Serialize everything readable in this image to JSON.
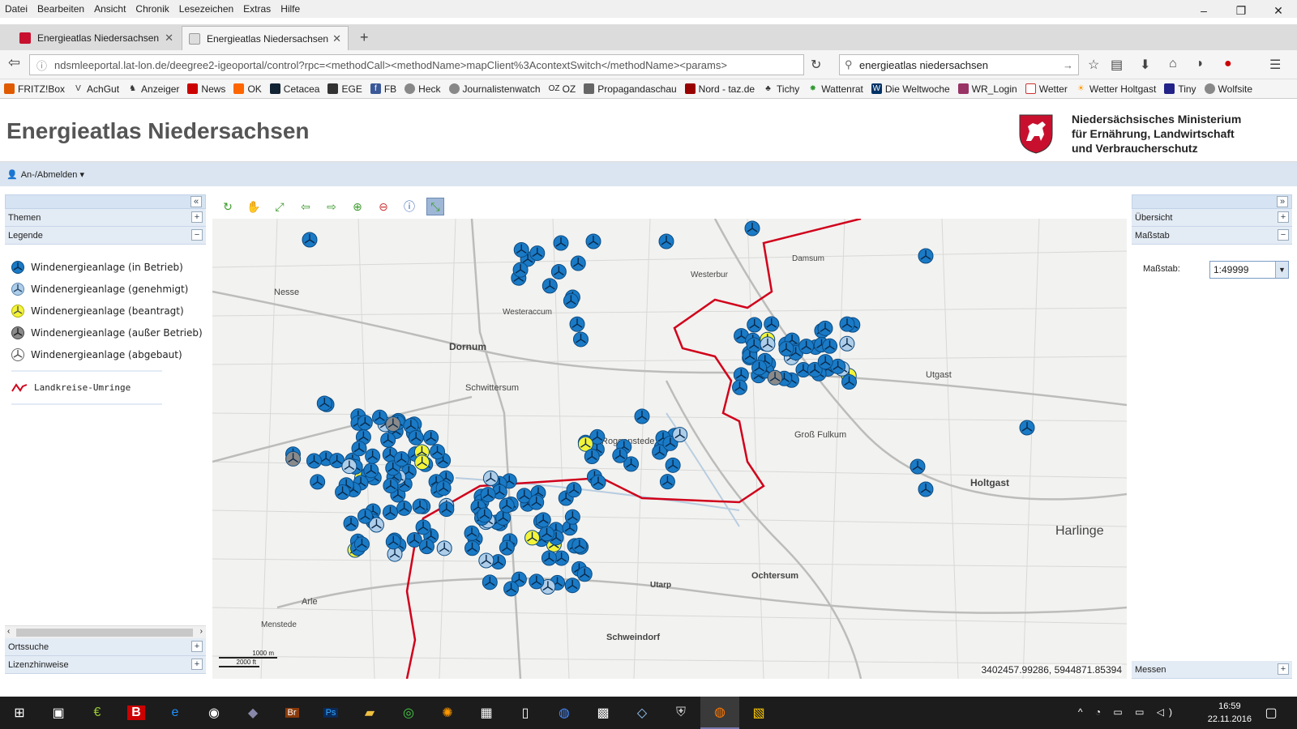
{
  "browser": {
    "menu": [
      "Datei",
      "Bearbeiten",
      "Ansicht",
      "Chronik",
      "Lesezeichen",
      "Extras",
      "Hilfe"
    ],
    "window_controls": {
      "minimize": "–",
      "maximize": "❐",
      "close": "✕"
    },
    "tabs": [
      {
        "label": "Energieatlas Niedersachsen",
        "active": false
      },
      {
        "label": "Energieatlas Niedersachsen",
        "active": true
      }
    ],
    "new_tab": "+",
    "url": "ndsmleeportal.lat-lon.de/deegree2-igeoportal/control?rpc=<methodCall><methodName>mapClient%3AcontextSwitch</methodName><params>",
    "search_value": "energieatlas niedersachsen",
    "bookmarks": [
      "FRITZ!Box",
      "AchGut",
      "Anzeiger",
      "News",
      "OK",
      "Cetacea",
      "EGE",
      "FB",
      "Heck",
      "Journalistenwatch",
      "OZ",
      "Propagandaschau",
      "Nord - taz.de",
      "Tichy",
      "Wattenrat",
      "Die Weltwoche",
      "WR_Login",
      "Wetter",
      "Wetter Holtgast",
      "Tiny",
      "Wolfsite"
    ]
  },
  "app": {
    "title": "Energieatlas Niedersachsen",
    "ministry": "Niedersächsisches Ministerium\nfür Ernährung, Landwirtschaft\nund Verbraucherschutz",
    "login_label": "An-/Abmelden ▾"
  },
  "left_panel": {
    "collapse": "«",
    "sections_top": [
      {
        "label": "Themen",
        "btn": "+"
      },
      {
        "label": "Legende",
        "btn": "−"
      }
    ],
    "legend": [
      {
        "label": "Windenergieanlage (in Betrieb)",
        "color": "#1a7ac6"
      },
      {
        "label": "Windenergieanlage (genehmigt)",
        "color": "#aecde9"
      },
      {
        "label": "Windenergieanlage (beantragt)",
        "color": "#f3f33a"
      },
      {
        "label": "Windenergieanlage (außer Betrieb)",
        "color": "#8a8a8a"
      },
      {
        "label": "Windenergieanlage (abgebaut)",
        "color": "#ffffff"
      }
    ],
    "boundary_label": "Landkreise-Umringe",
    "sections_bottom": [
      {
        "label": "Ortssuche",
        "btn": "+"
      },
      {
        "label": "Lizenzhinweise",
        "btn": "+"
      }
    ]
  },
  "map": {
    "coordinates": "3402457.99286, 5944871.85394",
    "scale_top": "1000 m",
    "scale_bottom": "2000 ft",
    "places": [
      {
        "name": "Dornum"
      },
      {
        "name": "Westeraccum"
      },
      {
        "name": "Nesse"
      },
      {
        "name": "Schwittersum"
      },
      {
        "name": "Roggenstede"
      },
      {
        "name": "Westerbur"
      },
      {
        "name": "Damsum"
      },
      {
        "name": "Utgast"
      },
      {
        "name": "Groß Fulkum"
      },
      {
        "name": "Holtgast"
      },
      {
        "name": "Harlinge"
      },
      {
        "name": "Ochtersum"
      },
      {
        "name": "Utarp"
      },
      {
        "name": "Schweindorf"
      },
      {
        "name": "Arle"
      },
      {
        "name": "Menstede"
      }
    ]
  },
  "right_panel": {
    "collapse": "»",
    "sections": [
      {
        "label": "Übersicht",
        "btn": "+"
      },
      {
        "label": "Maßstab",
        "btn": "−"
      }
    ],
    "scale_label": "Maßstab:",
    "scale_value": "1:49999",
    "bottom_section": {
      "label": "Messen",
      "btn": "+"
    }
  },
  "taskbar": {
    "time": "16:59",
    "date": "22.11.2016"
  }
}
